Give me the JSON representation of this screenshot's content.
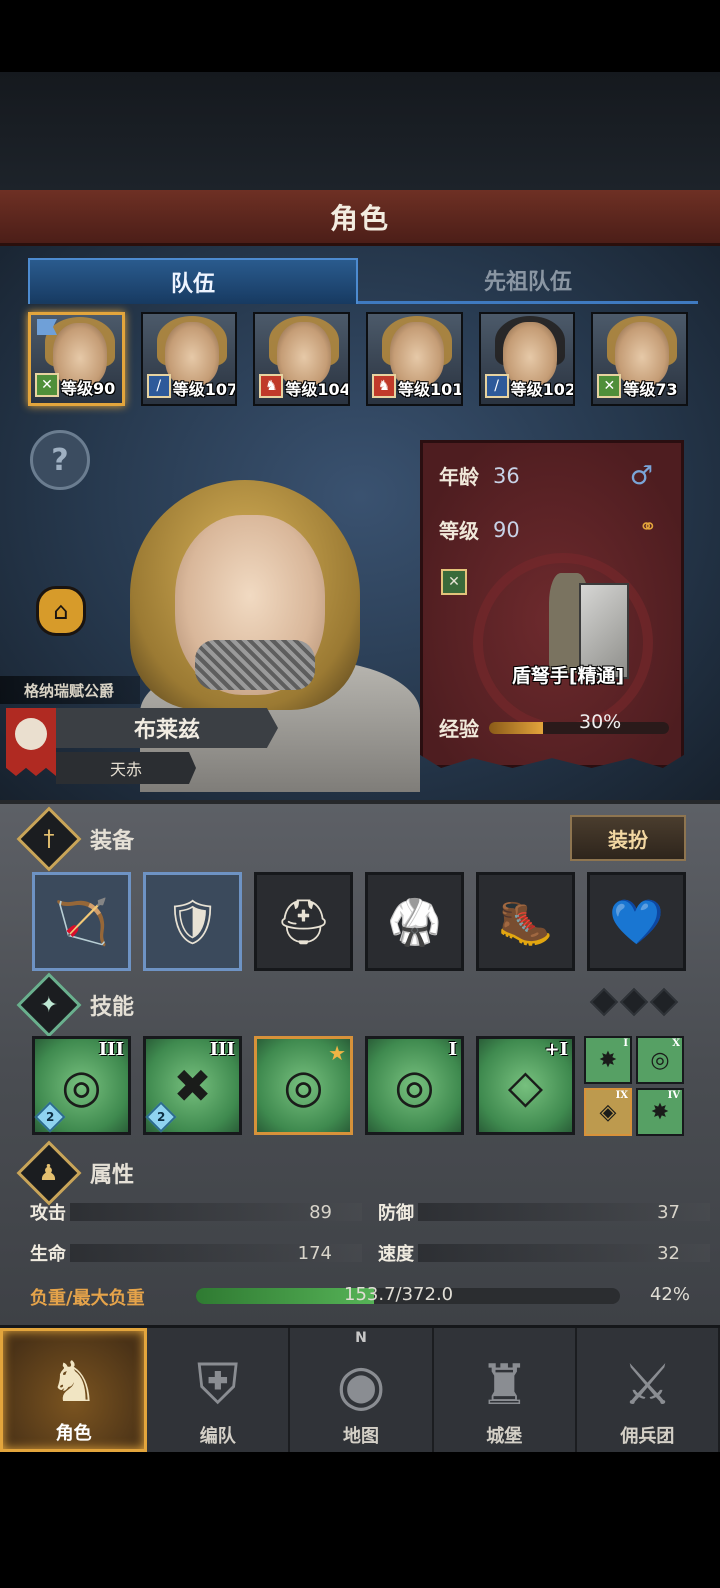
{
  "header": {
    "title": "角色"
  },
  "tabs": {
    "team": "队伍",
    "ancestor": "先祖队伍"
  },
  "roster": [
    {
      "level": "等级90",
      "class_icon": "crossbow-icon",
      "class_color": "#4f8f3a",
      "selected": true,
      "flag": true
    },
    {
      "level": "等级107",
      "class_icon": "sword-icon",
      "class_color": "#2e5a9a"
    },
    {
      "level": "等级104",
      "class_icon": "horse-icon",
      "class_color": "#c03a2a"
    },
    {
      "level": "等级101",
      "class_icon": "horse-icon",
      "class_color": "#c03a2a"
    },
    {
      "level": "等级102",
      "class_icon": "sword-icon",
      "class_color": "#2e5a9a",
      "dark_hair": true
    },
    {
      "level": "等级73",
      "class_icon": "crossbow-icon",
      "class_color": "#4f8f3a"
    }
  ],
  "hero": {
    "faction": "格纳瑞赋公爵",
    "name": "布莱兹",
    "title": "天赤"
  },
  "info": {
    "age_label": "年龄",
    "age": "36",
    "level_label": "等级",
    "level": "90",
    "class_name": "盾弩手[精通]",
    "exp_label": "经验",
    "exp_pct": "30%",
    "exp_fraction": 0.3,
    "gender_icon": "male-icon"
  },
  "equipment": {
    "title": "装备",
    "dress_button": "装扮",
    "slots": [
      {
        "name": "crossbow",
        "icon": "🏹",
        "rarity": "blue"
      },
      {
        "name": "pavise-shield",
        "icon": "🛡",
        "rarity": "blue"
      },
      {
        "name": "helmet",
        "icon": "⛑",
        "rarity": "normal"
      },
      {
        "name": "armor",
        "icon": "🥋",
        "rarity": "normal"
      },
      {
        "name": "boots",
        "icon": "🥾",
        "rarity": "normal"
      },
      {
        "name": "amulet",
        "icon": "💙",
        "rarity": "normal"
      }
    ]
  },
  "skills": {
    "title": "技能",
    "items": [
      {
        "rank": "III",
        "badge": "2",
        "icon": "◎"
      },
      {
        "rank": "III",
        "badge": "2",
        "icon": "✖"
      },
      {
        "rank": "",
        "star": true,
        "icon": "◎",
        "gold": true
      },
      {
        "rank": "I",
        "icon": "◎"
      },
      {
        "rank": "+I",
        "icon": "◇"
      }
    ],
    "mini": [
      {
        "rank": "I",
        "icon": "✸"
      },
      {
        "rank": "X",
        "icon": "◎"
      },
      {
        "rank": "IX",
        "icon": "◈",
        "gold": true
      },
      {
        "rank": "IV",
        "icon": "✸"
      }
    ]
  },
  "attributes": {
    "title": "属性",
    "attack_label": "攻击",
    "attack": "89",
    "defense_label": "防御",
    "defense": "37",
    "hp_label": "生命",
    "hp": "174",
    "speed_label": "速度",
    "speed": "32",
    "load_label": "负重/最大负重",
    "load_value": "153.7/372.0",
    "load_pct": "42%",
    "load_fraction": 0.42
  },
  "nav": {
    "items": [
      {
        "label": "角色",
        "icon": "knight-icon",
        "active": true
      },
      {
        "label": "编队",
        "icon": "helmet-icon"
      },
      {
        "label": "地图",
        "icon": "compass-icon"
      },
      {
        "label": "城堡",
        "icon": "castle-icon"
      },
      {
        "label": "佣兵团",
        "icon": "mercenary-icon"
      }
    ],
    "compass_n": "N"
  }
}
